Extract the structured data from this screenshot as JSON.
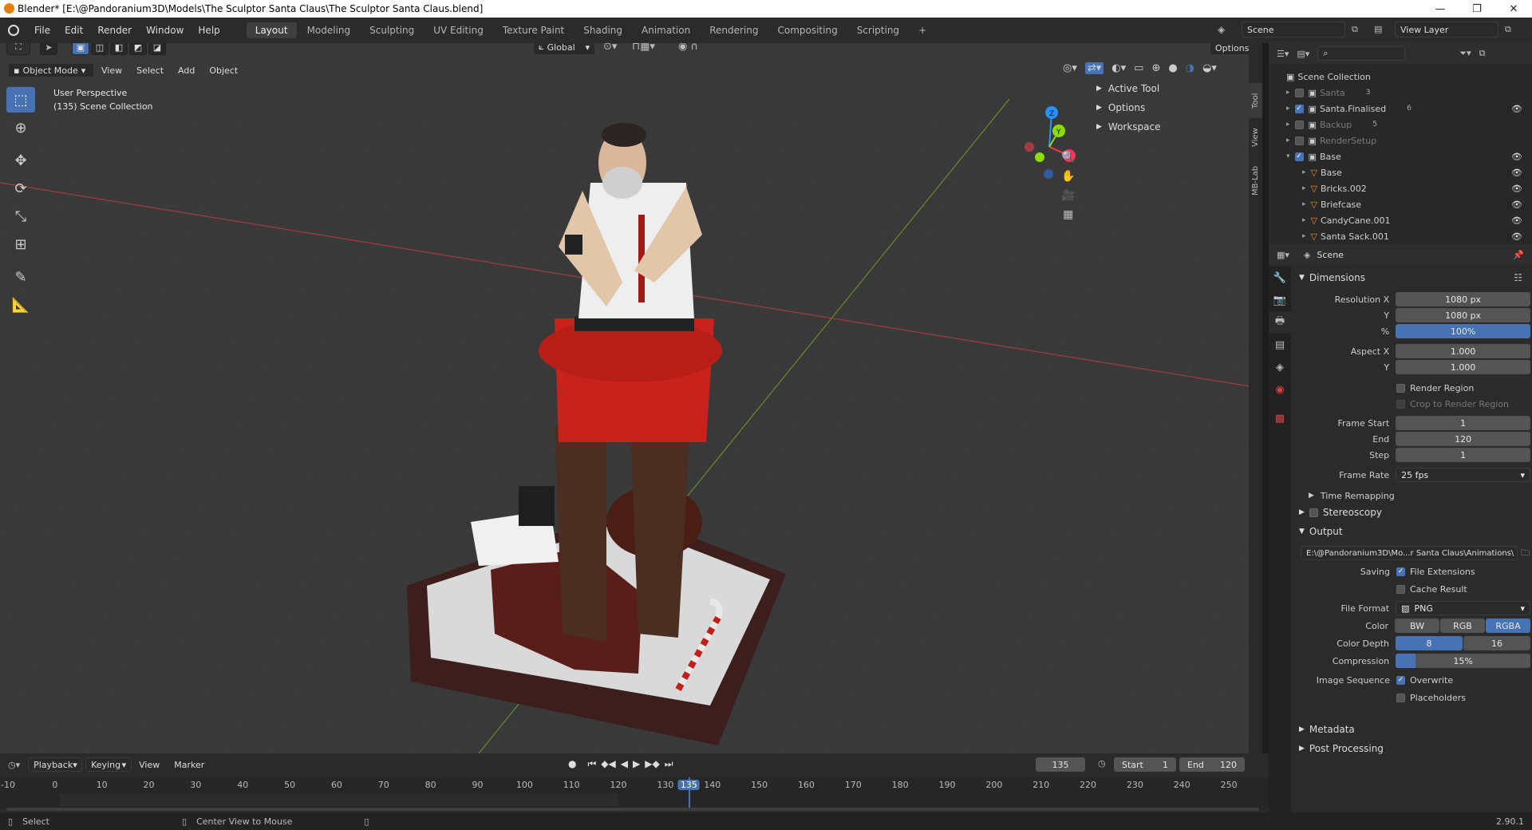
{
  "window": {
    "title": "Blender* [E:\\@Pandoranium3D\\Models\\The Sculptor Santa Claus\\The Sculptor Santa Claus.blend]",
    "minimize": "—",
    "maximize": "❐",
    "close": "✕"
  },
  "menus": [
    "File",
    "Edit",
    "Render",
    "Window",
    "Help"
  ],
  "workspaces": [
    "Layout",
    "Modeling",
    "Sculpting",
    "UV Editing",
    "Texture Paint",
    "Shading",
    "Animation",
    "Rendering",
    "Compositing",
    "Scripting"
  ],
  "add_workspace": "+",
  "scene_field": "Scene",
  "view_layer_field": "View Layer",
  "viewport": {
    "mode": "Object Mode",
    "menus": [
      "View",
      "Select",
      "Add",
      "Object"
    ],
    "transform_orientation": "Global",
    "options_btn": "Options",
    "perspective": "User Perspective",
    "collection": "(135) Scene Collection",
    "sidebar_items": [
      "Active Tool",
      "Options",
      "Workspace"
    ],
    "side_tabs": [
      "Tool",
      "View",
      "MB-Lab"
    ],
    "gizmo_axes": {
      "x": "X",
      "y": "Y",
      "z": "Z"
    }
  },
  "outliner": {
    "root": "Scene Collection",
    "rows": [
      {
        "name": "Santa",
        "checked": false,
        "dim": true,
        "badge": "3"
      },
      {
        "name": "Santa.Finalised",
        "checked": true,
        "dim": false,
        "badge": "6"
      },
      {
        "name": "Backup",
        "checked": false,
        "dim": true,
        "badge": "5"
      },
      {
        "name": "RenderSetup",
        "checked": false,
        "dim": true,
        "badge": ""
      },
      {
        "name": "Base",
        "checked": true,
        "dim": false,
        "badge": ""
      },
      {
        "name": "Base",
        "checked": true,
        "dim": false,
        "badge": ""
      },
      {
        "name": "Bricks.002",
        "checked": true,
        "dim": false,
        "badge": ""
      },
      {
        "name": "Briefcase",
        "checked": true,
        "dim": false,
        "badge": ""
      },
      {
        "name": "CandyCane.001",
        "checked": true,
        "dim": false,
        "badge": ""
      },
      {
        "name": "Santa Sack.001",
        "checked": true,
        "dim": false,
        "badge": ""
      }
    ]
  },
  "properties": {
    "context": "Scene",
    "dimensions_title": "Dimensions",
    "res_x_label": "Resolution X",
    "res_x": "1080 px",
    "res_y_label": "Y",
    "res_y": "1080 px",
    "pct_label": "%",
    "pct": "100%",
    "aspect_x_label": "Aspect X",
    "aspect_x": "1.000",
    "aspect_y_label": "Y",
    "aspect_y": "1.000",
    "render_region": "Render Region",
    "crop_region": "Crop to Render Region",
    "frame_start_label": "Frame Start",
    "frame_start": "1",
    "end_label": "End",
    "end": "120",
    "step_label": "Step",
    "step": "1",
    "frame_rate_label": "Frame Rate",
    "frame_rate": "25 fps",
    "time_remapping": "Time Remapping",
    "stereoscopy": "Stereoscopy",
    "output_title": "Output",
    "output_path": "E:\\@Pandoranium3D\\Mo...r Santa Claus\\Animations\\",
    "saving_label": "Saving",
    "file_extensions": "File Extensions",
    "cache_result": "Cache Result",
    "file_format_label": "File Format",
    "file_format": "PNG",
    "color_label": "Color",
    "color_opts": [
      "BW",
      "RGB",
      "RGBA"
    ],
    "color_depth_label": "Color Depth",
    "depth_opts": [
      "8",
      "16"
    ],
    "compression_label": "Compression",
    "compression": "15%",
    "compression_frac": 0.15,
    "image_sequence_label": "Image Sequence",
    "overwrite": "Overwrite",
    "placeholders": "Placeholders",
    "metadata": "Metadata",
    "post_processing": "Post Processing"
  },
  "timeline": {
    "menus": [
      "Playback",
      "Keying",
      "View",
      "Marker"
    ],
    "current_frame": "135",
    "start_label": "Start",
    "start": "1",
    "end_label": "End",
    "end": "120",
    "ticks": [
      "-10",
      "0",
      "10",
      "20",
      "30",
      "40",
      "50",
      "60",
      "70",
      "80",
      "90",
      "100",
      "110",
      "120",
      "130",
      "135",
      "140",
      "150",
      "160",
      "170",
      "180",
      "190",
      "200",
      "210",
      "220",
      "230",
      "240",
      "250"
    ]
  },
  "status": {
    "select": "Select",
    "center_view": "Center View to Mouse",
    "version": "2.90.1"
  },
  "colors": {
    "accent": "#4772b3",
    "viewport_bg": "#393939",
    "x_axis": "#ff3352",
    "y_axis": "#8bdc00",
    "z_axis": "#2890ff"
  }
}
